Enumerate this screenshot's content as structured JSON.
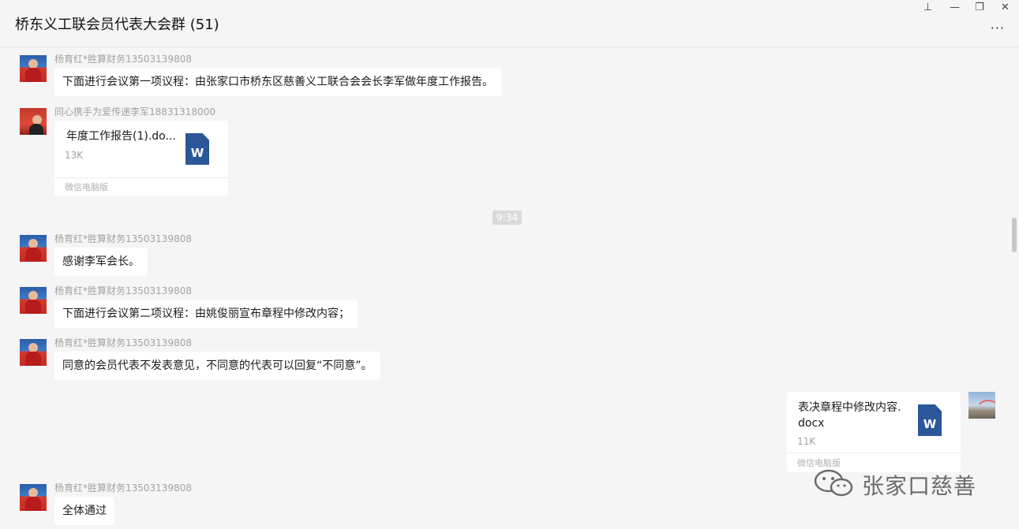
{
  "window": {
    "title": "桥东义工联会员代表大会群 (51)",
    "controls": {
      "pin": "⊥",
      "minimize": "—",
      "restore": "❐",
      "close": "✕"
    },
    "more": "···"
  },
  "messages": [
    {
      "sender": "杨育红*胜算财务13503139808",
      "text": "下面进行会议第一项议程：由张家口市桥东区慈善义工联合会会长李军做年度工作报告。"
    },
    {
      "sender": "同心携手为爱传递李军18831318000",
      "file": {
        "name": "年度工作报告(1).do...",
        "size": "13K",
        "source": "微信电脑版",
        "icon": "W"
      }
    },
    {
      "time": "9:34"
    },
    {
      "sender": "杨育红*胜算财务13503139808",
      "text": "感谢李军会长。"
    },
    {
      "sender": "杨育红*胜算财务13503139808",
      "text": "下面进行会议第二项议程：由姚俊丽宣布章程中修改内容；"
    },
    {
      "sender": "杨育红*胜算财务13503139808",
      "text": "同意的会员代表不发表意见，不同意的代表可以回复“不同意”。"
    },
    {
      "self": true,
      "file": {
        "name_line1": "表决章程中修改内容.",
        "name_line2": "docx",
        "size": "11K",
        "source": "微信电脑版",
        "icon": "W"
      }
    },
    {
      "sender": "杨育红*胜算财务13503139808",
      "text": "全体通过"
    }
  ],
  "watermark": {
    "text": "张家口慈善"
  }
}
